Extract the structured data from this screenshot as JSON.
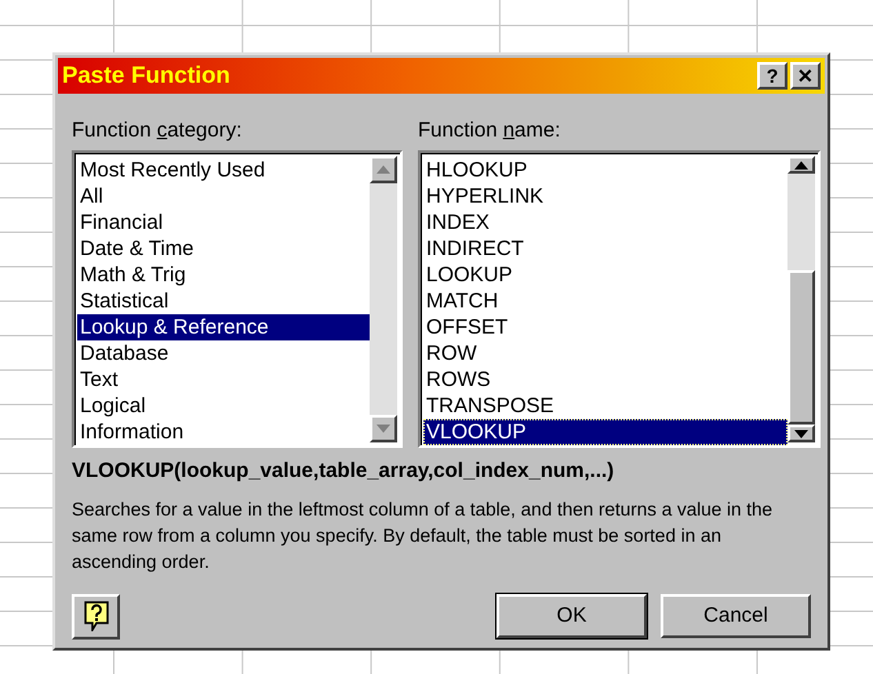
{
  "window": {
    "title": "Paste Function",
    "title_buttons": [
      "?",
      "✕"
    ]
  },
  "category": {
    "label": {
      "before": "Function ",
      "access_key": "c",
      "after": "ategory:"
    },
    "items": [
      {
        "label": "Most Recently Used",
        "selected": false
      },
      {
        "label": "All",
        "selected": false
      },
      {
        "label": "Financial",
        "selected": false
      },
      {
        "label": "Date & Time",
        "selected": false
      },
      {
        "label": "Math & Trig",
        "selected": false
      },
      {
        "label": "Statistical",
        "selected": false
      },
      {
        "label": "Lookup & Reference",
        "selected": true
      },
      {
        "label": "Database",
        "selected": false
      },
      {
        "label": "Text",
        "selected": false
      },
      {
        "label": "Logical",
        "selected": false
      },
      {
        "label": "Information",
        "selected": false
      }
    ]
  },
  "function": {
    "label": {
      "before": "Function ",
      "access_key": "n",
      "after": "ame:"
    },
    "items": [
      {
        "label": "HLOOKUP",
        "selected": false
      },
      {
        "label": "HYPERLINK",
        "selected": false
      },
      {
        "label": "INDEX",
        "selected": false
      },
      {
        "label": "INDIRECT",
        "selected": false
      },
      {
        "label": "LOOKUP",
        "selected": false
      },
      {
        "label": "MATCH",
        "selected": false
      },
      {
        "label": "OFFSET",
        "selected": false
      },
      {
        "label": "ROW",
        "selected": false
      },
      {
        "label": "ROWS",
        "selected": false
      },
      {
        "label": "TRANSPOSE",
        "selected": false
      },
      {
        "label": "VLOOKUP",
        "selected": true
      }
    ]
  },
  "syntax": "VLOOKUP(lookup_value,table_array,col_index_num,...)",
  "description": "Searches for a value in the leftmost column of a table, and then returns a value in the same row from a column you specify. By default, the table must be sorted in an ascending order.",
  "buttons": [
    "OK",
    "Cancel"
  ]
}
